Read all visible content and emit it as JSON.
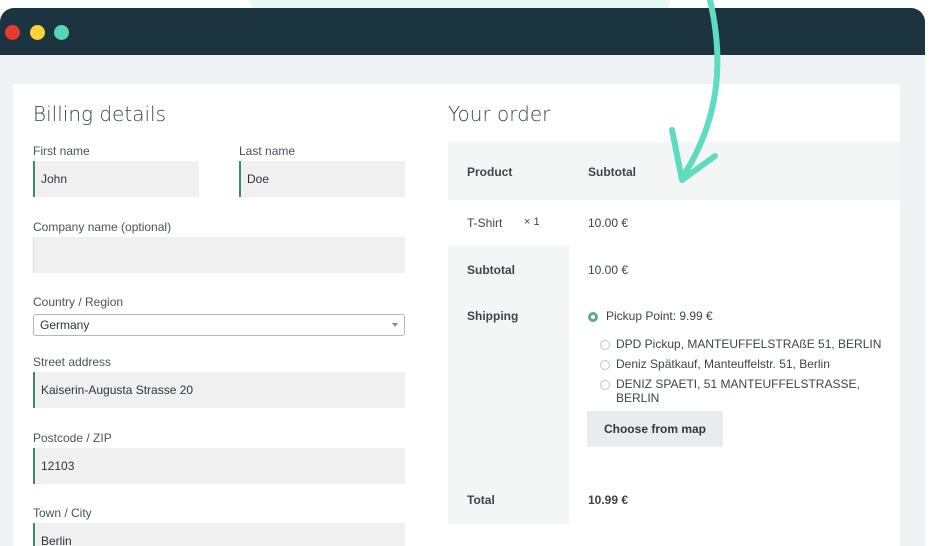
{
  "colors": {
    "titlebar": "#1b3440",
    "accent_teal": "#5fdcbf",
    "input_border": "#3d8a6a",
    "page_bg": "#eef2f2"
  },
  "window": {
    "controls": [
      "close-dot",
      "minimize-dot",
      "maximize-dot"
    ]
  },
  "billing": {
    "title": "Billing details",
    "first_name": {
      "label": "First name",
      "value": "John"
    },
    "last_name": {
      "label": "Last name",
      "value": "Doe"
    },
    "company": {
      "label": "Company name (optional)",
      "value": ""
    },
    "country": {
      "label": "Country / Region",
      "value": "Germany"
    },
    "street": {
      "label": "Street address",
      "value": "Kaiserin-Augusta Strasse 20"
    },
    "postcode": {
      "label": "Postcode / ZIP",
      "value": "12103"
    },
    "city": {
      "label": "Town / City",
      "value": "Berlin"
    }
  },
  "order": {
    "title": "Your order",
    "col_product": "Product",
    "col_subtotal": "Subtotal",
    "item": {
      "name": "T-Shirt",
      "qty": "× 1",
      "price": "10.00 €"
    },
    "subtotal": {
      "label": "Subtotal",
      "value": "10.00 €"
    },
    "shipping": {
      "label": "Shipping",
      "options": [
        {
          "text": "Pickup Point: 9.99 €",
          "checked": true
        },
        {
          "text": "DPD Pickup, MANTEUFFELSTRAßE 51, BERLIN",
          "checked": false
        },
        {
          "text": "Deniz Spätkauf, Manteuffelstr. 51, Berlin",
          "checked": false
        },
        {
          "text": "DENIZ SPAETI, 51 MANTEUFFELSTRASSE, BERLIN",
          "checked": false
        }
      ],
      "map_button": "Choose from map"
    },
    "total": {
      "label": "Total",
      "value": "10.99 €"
    }
  }
}
